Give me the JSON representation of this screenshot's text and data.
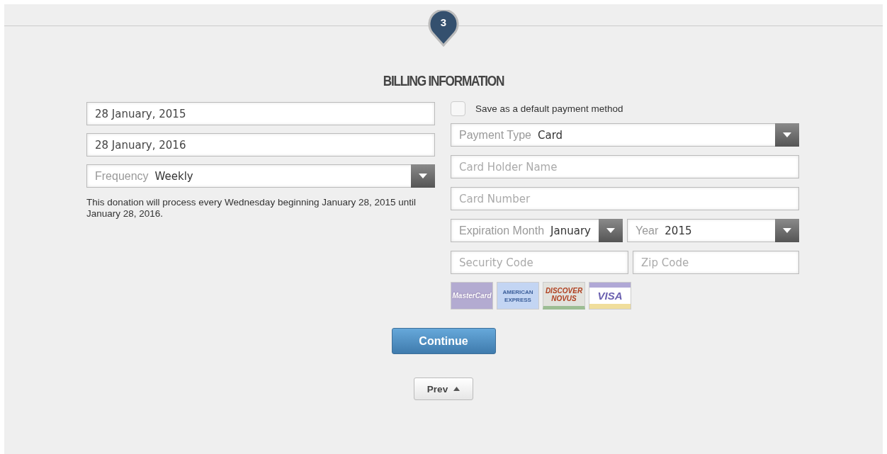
{
  "step": {
    "number": "3"
  },
  "title": "BILLING INFORMATION",
  "left_fields": [
    {
      "kind": "input",
      "value": "28 January, 2015"
    },
    {
      "kind": "input",
      "value": "28 January, 2016"
    },
    {
      "kind": "select",
      "label": "Frequency",
      "value": "Weekly"
    }
  ],
  "note": "This donation will process every Wednesday beginning January 28, 2015 until January 28, 2016.",
  "save_default": {
    "label": "Save as a default payment method",
    "checked": false
  },
  "right_rows": [
    [
      {
        "kind": "select",
        "label": "Payment Type",
        "value": "Card"
      }
    ],
    [
      {
        "kind": "input",
        "placeholder": "Card Holder Name"
      }
    ],
    [
      {
        "kind": "input",
        "placeholder": "Card Number"
      }
    ],
    [
      {
        "kind": "select",
        "label": "Expiration Month",
        "value": "January"
      },
      {
        "kind": "select",
        "label": "Year",
        "value": "2015"
      }
    ],
    [
      {
        "kind": "input",
        "placeholder": "Security Code"
      },
      {
        "kind": "input",
        "placeholder": "Zip Code"
      }
    ]
  ],
  "cards": [
    {
      "kind": "mastercard",
      "lines": [
        "MasterCard"
      ]
    },
    {
      "kind": "amex",
      "lines": [
        "AMERICAN",
        "EXPRESS"
      ]
    },
    {
      "kind": "discover",
      "lines": [
        "DISCOVER",
        "NOVUS"
      ]
    },
    {
      "kind": "visa",
      "lines": [
        "VISA"
      ]
    }
  ],
  "continue_button": "Continue",
  "prev_button": "Prev"
}
